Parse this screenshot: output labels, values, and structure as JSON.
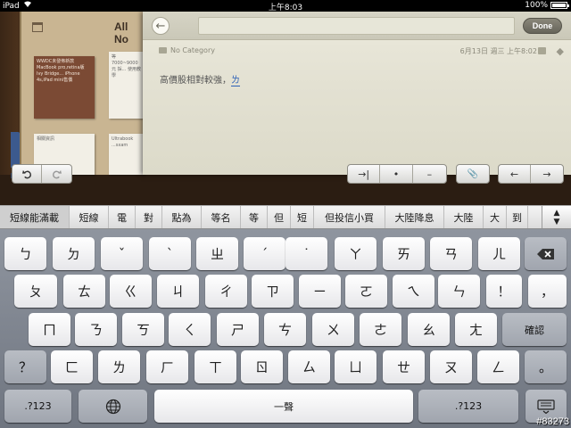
{
  "status_bar": {
    "device": "iPad",
    "time": "上午8:03",
    "battery": "100%"
  },
  "left_panel": {
    "title": "All No",
    "cards": [
      {
        "text": "WWDC未發佈新款MacBook pro,retina版 Ivy Bridge... iPhone 4s,iPad mini售價"
      },
      {
        "text": "等 7000~9000元 採... 使用教學"
      },
      {
        "text": "相關資訊"
      },
      {
        "text": "Ultrabook ...sxam"
      }
    ]
  },
  "editor": {
    "done_label": "Done",
    "category": "No Category",
    "date": "6月13日 週三 上午8:02",
    "body_text": "高價股相對較強，",
    "composing_text": "ㄌ"
  },
  "toolbar": {
    "indent": "→|",
    "bullet": "•",
    "dash": "–",
    "attach": "📎",
    "prev": "←",
    "next": "→"
  },
  "candidates": [
    "短線能滿載",
    "短線",
    "電",
    "對",
    "點為",
    "等名",
    "等",
    "但",
    "短",
    "但投信小買",
    "大陸降息",
    "大陸",
    "大",
    "到"
  ],
  "keyboard": {
    "row1": [
      "ㄅ",
      "ㄉ",
      "ˇ",
      "ˋ",
      "ㄓ",
      "ˊ",
      "˙",
      "ㄚ",
      "ㄞ",
      "ㄢ",
      "ㄦ"
    ],
    "row2": [
      "ㄆ",
      "ㄊ",
      "ㄍ",
      "ㄐ",
      "ㄔ",
      "ㄗ",
      "ㄧ",
      "ㄛ",
      "ㄟ",
      "ㄣ",
      "！",
      "，"
    ],
    "row3": [
      "ㄇ",
      "ㄋ",
      "ㄎ",
      "ㄑ",
      "ㄕ",
      "ㄘ",
      "ㄨ",
      "ㄜ",
      "ㄠ",
      "ㄤ"
    ],
    "confirm": "確認",
    "row4": [
      "？",
      "ㄈ",
      "ㄌ",
      "ㄏ",
      "ㄒ",
      "ㄖ",
      "ㄙ",
      "ㄩ",
      "ㄝ",
      "ㄡ",
      "ㄥ",
      "。"
    ],
    "numbers_left": ".?123",
    "space": "一聲",
    "numbers_right": ".?123"
  },
  "watermark": "#83273"
}
